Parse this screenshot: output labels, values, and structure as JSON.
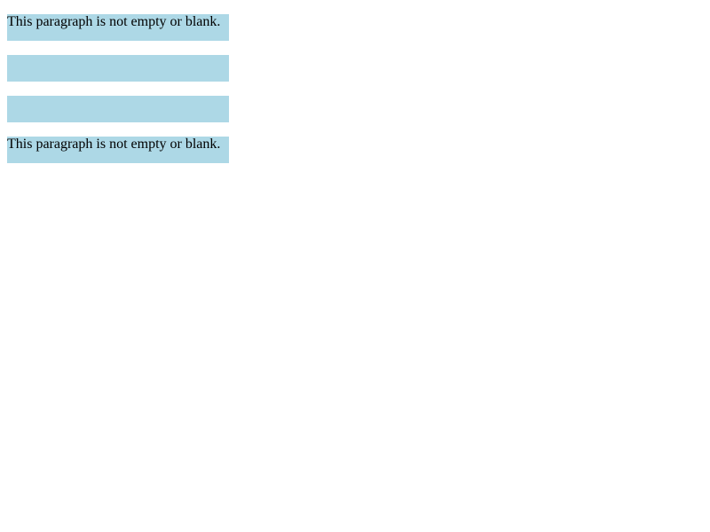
{
  "paragraphs": [
    {
      "text": "This paragraph is not empty or blank."
    },
    {
      "text": ""
    },
    {
      "text": ""
    },
    {
      "text": "This paragraph is not empty or blank."
    }
  ],
  "colors": {
    "paragraph_background": "#add8e6",
    "page_background": "#ffffff",
    "text": "#000000"
  }
}
